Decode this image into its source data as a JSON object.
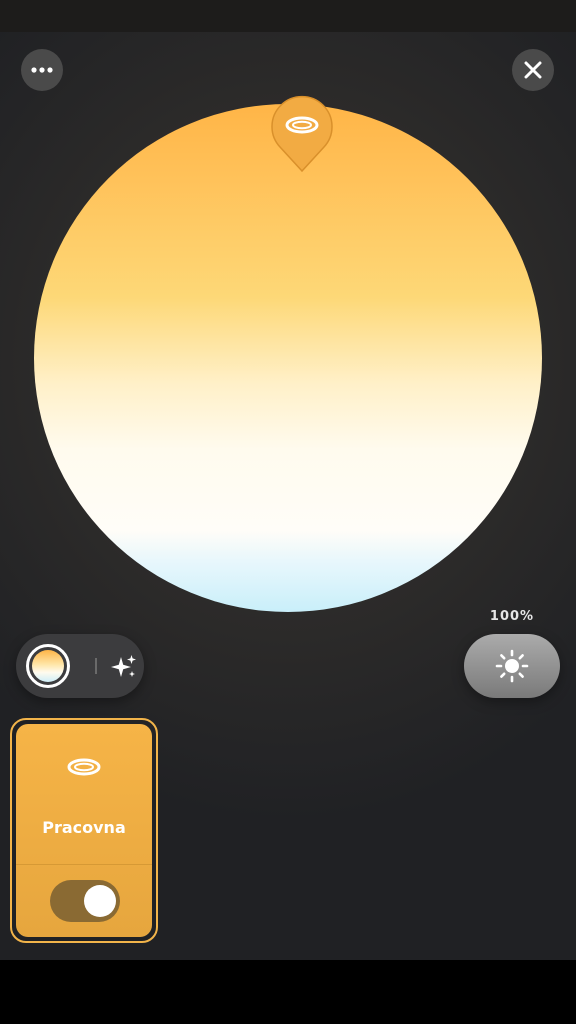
{
  "header": {
    "more_icon": "more-horizontal-icon",
    "close_icon": "close-x-icon"
  },
  "color_wheel": {
    "type": "color-temperature",
    "colors": {
      "warm_top": "#ffb547",
      "mid": "#fdd877",
      "neutral": "#fffdf8",
      "cool_bottom": "#c9effa"
    },
    "pin_icon": "ceiling-light-icon"
  },
  "mode_switch": {
    "color_mode_icon": "color-swatch-icon",
    "scenes_icon": "sparkle-icon",
    "selected": "color"
  },
  "brightness": {
    "label": "100%",
    "icon": "sun-icon"
  },
  "lights": [
    {
      "name": "Pracovna",
      "icon": "ceiling-light-icon",
      "on": true,
      "accent": "#f6b447"
    }
  ]
}
